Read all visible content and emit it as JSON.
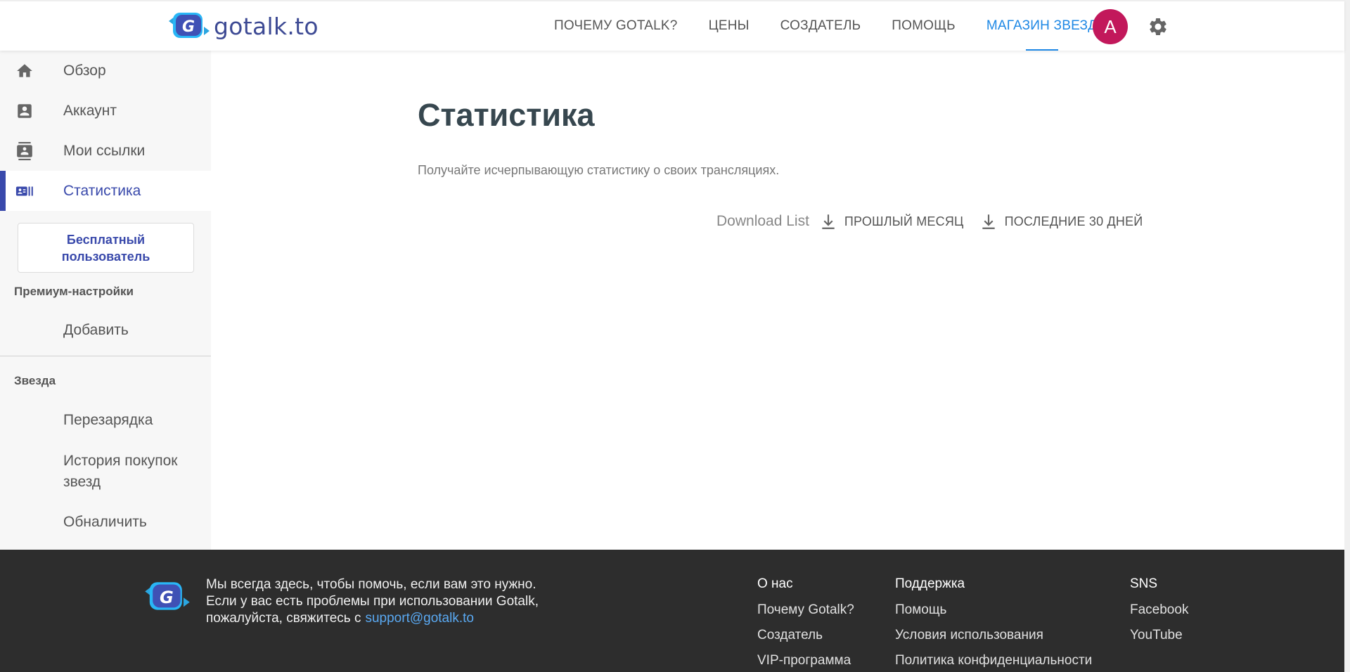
{
  "header": {
    "logo_text": "gotalk.to",
    "nav": [
      {
        "label": "ПОЧЕМУ GOTALK?"
      },
      {
        "label": "ЦЕНЫ"
      },
      {
        "label": "СОЗДАТЕЛЬ"
      },
      {
        "label": "ПОМОЩЬ"
      },
      {
        "label": "МАГАЗИН ЗВЕЗД"
      }
    ],
    "avatar_letter": "A",
    "icons": {
      "settings": "gear-icon"
    }
  },
  "sidebar": {
    "items": [
      {
        "label": "Обзор",
        "icon": "home-icon"
      },
      {
        "label": "Аккаунт",
        "icon": "account-box-icon"
      },
      {
        "label": "Мои ссылки",
        "icon": "contacts-icon"
      },
      {
        "label": "Статистика",
        "icon": "stats-card-icon"
      }
    ],
    "badge": "Бесплатный пользователь",
    "premium_section": "Премиум-настройки",
    "premium_items": [
      {
        "label": "Добавить"
      }
    ],
    "star_section": "Звезда",
    "star_items": [
      {
        "label": "Перезарядка"
      },
      {
        "label": "История покупок звезд"
      },
      {
        "label": "Обналичить"
      }
    ]
  },
  "main": {
    "title": "Статистика",
    "description": "Получайте исчерпывающую статистику о своих трансляциях.",
    "download_label": "Download List",
    "download_buttons": [
      {
        "label": "ПРОШЛЫЙ МЕСЯЦ"
      },
      {
        "label": "ПОСЛЕДНИЕ 30 ДНЕЙ"
      }
    ]
  },
  "footer": {
    "text_line1": "Мы всегда здесь, чтобы помочь, если вам это нужно.",
    "text_line2": "Если у вас есть проблемы при использовании Gotalk,",
    "text_line3": "пожалуйста, свяжитесь с",
    "email": "support@gotalk.to",
    "columns": [
      {
        "head": "О нас",
        "links": [
          "Почему Gotalk?",
          "Создатель",
          "VIP-программа"
        ]
      },
      {
        "head": "Поддержка",
        "links": [
          "Помощь",
          "Условия использования",
          "Политика конфиденциальности"
        ]
      },
      {
        "head": "SNS",
        "links": [
          "Facebook",
          "YouTube"
        ]
      }
    ]
  },
  "colors": {
    "accent_blue": "#1e88e5",
    "indigo": "#3949ab",
    "logo_navy": "#3d4a94",
    "avatar": "#c2185b",
    "footer_bg": "#2d2d2d",
    "footer_link": "#5aa9f2"
  }
}
